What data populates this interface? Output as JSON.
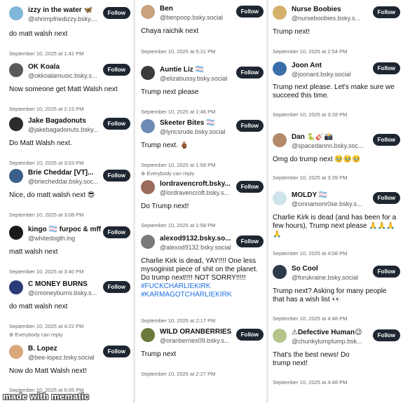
{
  "columns": [
    {
      "posts": [
        {
          "name": "izzy in the water 🦋",
          "handle": "@shrimpfriedizzy.bsky....",
          "follow": "Follow",
          "text": "do matt walsh next",
          "time": "September 10, 2025 at 1:42 PM",
          "avatar_color": "#7fb6d9"
        },
        {
          "name": "OK Koala",
          "handle": "@okkoalamusic.bsky.s...",
          "follow": "Follow",
          "text": "Now someone get Matt Walsh next",
          "time": "September 10, 2025 at 2:15 PM",
          "avatar_color": "#5a5a5a"
        },
        {
          "name": "Jake Bagadonuts",
          "handle": "@jakebagadonuts.bsky...",
          "follow": "Follow",
          "text": "Do Matt Walsh next.",
          "time": "September 10, 2025 at 3:03 PM",
          "avatar_color": "#2b2b2b"
        },
        {
          "name": "Brie Cheddar [VT]...",
          "handle": "@briecheddar.bsky.soc...",
          "follow": "Follow",
          "text": "Nice, do matt walsh next 😎",
          "time": "September 10, 2025 at 3:08 PM",
          "avatar_color": "#3a5f8a"
        },
        {
          "name": "kingo 🏳️‍⚧️ furpoc & mff",
          "handle": "@whitedogth.ing",
          "follow": "Follow",
          "text": "matt walsh next",
          "time": "September 10, 2025 at 3:40 PM",
          "avatar_color": "#1a1a1a"
        },
        {
          "name": "C MONEY BURNS",
          "handle": "@cmoneyburns.bsky.s...",
          "follow": "Follow",
          "text": "do matt walsh next",
          "time": "September 10, 2025 at 4:22 PM",
          "meta": "Everybody can reply",
          "avatar_color": "#2a3b7a"
        },
        {
          "name": "B. Lopez",
          "handle": "@bee-lopez.bsky.social",
          "follow": "Follow",
          "text": "Now do Matt Walsh next!",
          "time": "September 10, 2025 at 6:05 PM",
          "avatar_color": "#d9a77a"
        }
      ]
    },
    {
      "posts": [
        {
          "name": "Ben",
          "handle": "@benpoop.bsky.social",
          "follow": "Follow",
          "text": "Chaya raichik next",
          "time": "September 10, 2025 at 5:31 PM",
          "avatar_color": "#c9a27e"
        },
        {
          "name": "Auntie Liz 🏳️‍⚧️",
          "handle": "@elizabussy.bsky.social",
          "follow": "Follow",
          "text": "Trump next please",
          "time": "September 10, 2025 at 1:46 PM",
          "avatar_color": "#3b3b3b"
        },
        {
          "name": "Skeeter Bites 🏳️‍⚧️",
          "handle": "@lyricsrude.bsky.social",
          "follow": "Follow",
          "text": "Trump next. 🖕🏾",
          "time": "September 10, 2025 at 1:58 PM",
          "meta": "Everybody can reply",
          "avatar_color": "#6d8bb5"
        },
        {
          "name": "lordravencroft.bsky...",
          "handle": "@lordravencroft.bsky.s...",
          "follow": "Follow",
          "text": "Do Trump next!",
          "time": "September 10, 2025 at 1:58 PM",
          "avatar_color": "#9a6b5a"
        },
        {
          "name": "alexod9132.bsky.so...",
          "handle": "@alexod9132.bsky.social",
          "follow": "Follow",
          "text": "Charlie Kirk is dead, YAY!!!! One less mysoginist piece of shit on the planet. Do trump next!!!! NOT SORRY!!!!!",
          "tags": [
            "#FUCKCHARLIEKIRK",
            "#KARMAGOTCHARLIEKIRK"
          ],
          "time": "September 10, 2025 at 2:17 PM",
          "avatar_color": "#7a7a7a"
        },
        {
          "name": "WILD ORANBERRIES",
          "handle": "@oranberries09.bsky.s...",
          "follow": "Follow",
          "text": "Trump next",
          "time": "September 10, 2025 at 2:27 PM",
          "avatar_color": "#6b7a3a"
        }
      ]
    },
    {
      "posts": [
        {
          "name": "Nurse Boobies",
          "handle": "@nurseboobies.bsky.s...",
          "follow": "Follow",
          "text": "Trump next!",
          "time": "September 10, 2025 at 2:54 PM",
          "avatar_color": "#d4b06a"
        },
        {
          "name": "Joon Ant",
          "handle": "@joonant.bsky.social",
          "follow": "Follow",
          "text": "Trump next please. Let's make sure we succeed this time.",
          "time": "September 10, 2025 at 3:28 PM",
          "avatar_color": "#3a6ea8"
        },
        {
          "name": "Dan 🐍🎸📸",
          "handle": "@spacedannn.bsky.soc...",
          "follow": "Follow",
          "text": "Omg do trump next 🥹🥹🥹",
          "time": "September 10, 2025 at 3:39 PM",
          "avatar_color": "#b58a6a"
        },
        {
          "name": "MOLDY 🏳️‍⚧️",
          "handle": "@cinnamonr0se.bsky.s...",
          "follow": "Follow",
          "text": "Charlie Kirk is dead (and has been for a few hours), Trump next please 🙏🙏🙏🙏",
          "time": "September 10, 2025 at 4:08 PM",
          "avatar_color": "#cfe3ea"
        },
        {
          "name": "So Cool",
          "handle": "@forukraine.bsky.social",
          "follow": "Follow",
          "text": "Trump next? Asking for many people that has a wish list 👀",
          "time": "September 10, 2025 at 4:48 PM",
          "avatar_color": "#2c3a4a"
        },
        {
          "name": "⚠Defective Human😉",
          "handle": "@chunkylumplump.bsk...",
          "follow": "Follow",
          "text": "That's the best news! Do trump next!",
          "time": "September 10, 2025 at 4:48 PM",
          "avatar_color": "#b5c48a"
        }
      ]
    }
  ],
  "watermark": "made with mematic"
}
